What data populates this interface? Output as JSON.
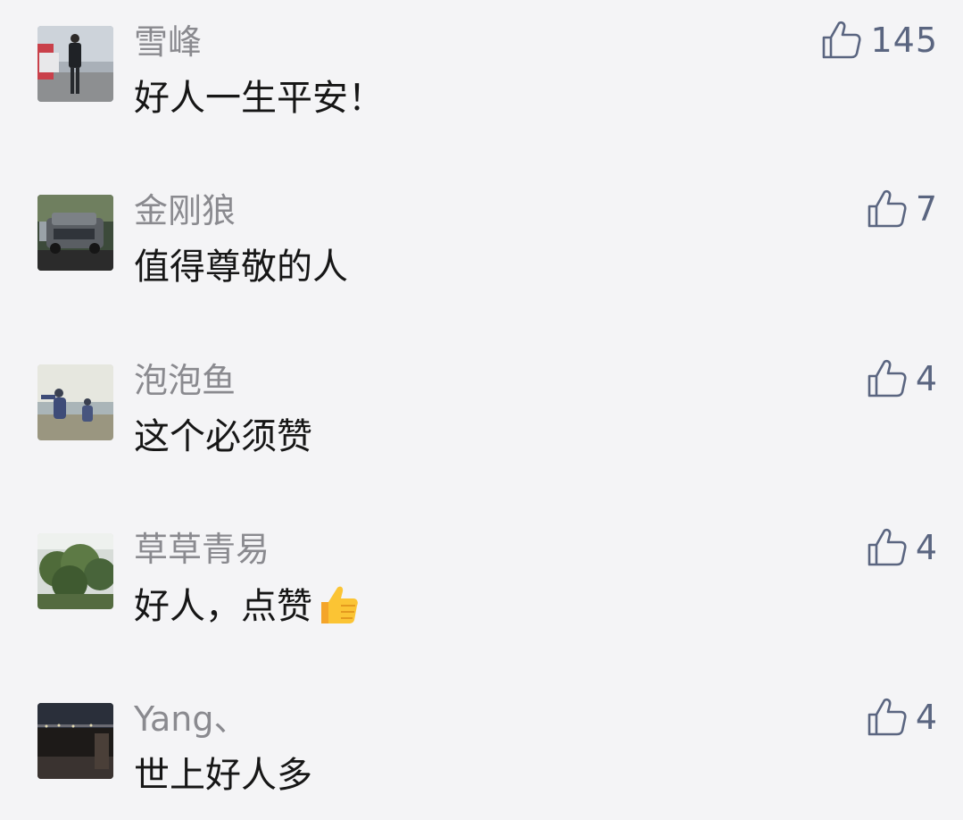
{
  "comments": [
    {
      "nickname": "雪峰",
      "content": "好人一生平安！",
      "likes": "145",
      "avatar": "avatar-person-standing"
    },
    {
      "nickname": "金刚狼",
      "content": "值得尊敬的人",
      "likes": "7",
      "avatar": "avatar-suv-car"
    },
    {
      "nickname": "泡泡鱼",
      "content": "这个必须赞",
      "likes": "4",
      "avatar": "avatar-kids-lake"
    },
    {
      "nickname": "草草青易",
      "content": "好人，点赞",
      "likes": "4",
      "avatar": "avatar-green-tree",
      "emoji": "thumbs-up-emoji"
    },
    {
      "nickname": "Yang、",
      "content": "世上好人多",
      "likes": "4",
      "avatar": "avatar-night-view"
    }
  ],
  "colors": {
    "background": "#f4f4f6",
    "nickname": "#8a8a8f",
    "content": "#161616",
    "like": "#5a6580"
  },
  "icons": {
    "like": "thumbs-up-outline-icon"
  }
}
